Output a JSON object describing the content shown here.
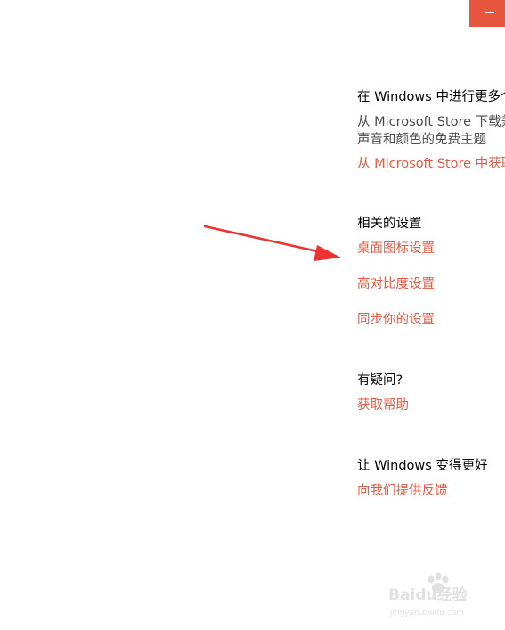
{
  "colors": {
    "accent": "#e8563f",
    "link": "#e25b47",
    "heading": "#000000",
    "body": "#4a4a4a",
    "arrow": "#ee3232",
    "watermark": "#c9c9c9"
  },
  "titlebar": {
    "minimize_icon": "minimize-icon"
  },
  "sections": {
    "more_windows": {
      "heading": "在 Windows 中进行更多个",
      "desc_line1": "从 Microsoft Store 下载兼",
      "desc_line2": "声音和颜色的免费主题",
      "link": "从 Microsoft Store 中获取"
    },
    "related": {
      "heading": "相关的设置",
      "links": [
        "桌面图标设置",
        "高对比度设置",
        "同步你的设置"
      ]
    },
    "questions": {
      "heading": "有疑问?",
      "link": "获取帮助"
    },
    "feedback": {
      "heading": "让 Windows 变得更好",
      "link": "向我们提供反馈"
    }
  },
  "annotation": {
    "arrow_icon": "arrow-icon"
  },
  "watermark": {
    "logo_text": "Baidu经验",
    "url": "jingyan.baidu.com"
  }
}
